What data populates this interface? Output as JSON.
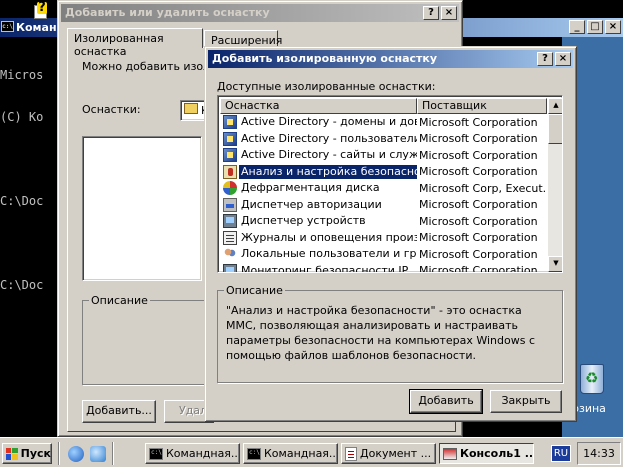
{
  "console": {
    "title": "Команд",
    "lines": [
      "Micros",
      "(C) Ко",
      "",
      "C:\\Doc",
      "",
      "C:\\Doc"
    ]
  },
  "back_dialog": {
    "title": "Добавить или удалить оснастку",
    "tabs": [
      "Изолированная оснастка",
      "Расширения"
    ],
    "intro_text": "Можно добавить изолир",
    "snapins_label": "Оснастки:",
    "combo_value": "К",
    "description_label": "Описание",
    "add_button": "Добавить...",
    "remove_button": "Удал"
  },
  "front_dialog": {
    "title": "Добавить изолированную оснастку",
    "available_label": "Доступные изолированные оснастки:",
    "columns": [
      "Оснастка",
      "Поставщик"
    ],
    "rows": [
      {
        "name": "Active Directory - домены и дове...",
        "vendor": "Microsoft Corporation",
        "icon": "ad"
      },
      {
        "name": "Active Directory - пользователи ...",
        "vendor": "Microsoft Corporation",
        "icon": "ad"
      },
      {
        "name": "Active Directory - сайты и службы",
        "vendor": "Microsoft Corporation",
        "icon": "ad"
      },
      {
        "name": "Анализ и настройка безопасности",
        "vendor": "Microsoft Corporation",
        "icon": "sec",
        "selected": true
      },
      {
        "name": "Дефрагментация диска",
        "vendor": "Microsoft Corp, Execut...",
        "icon": "defrag"
      },
      {
        "name": "Диспетчер авторизации",
        "vendor": "Microsoft Corporation",
        "icon": "auth"
      },
      {
        "name": "Диспетчер устройств",
        "vendor": "Microsoft Corporation",
        "icon": "dev"
      },
      {
        "name": "Журналы и оповещения произв...",
        "vendor": "Microsoft Corporation",
        "icon": "log"
      },
      {
        "name": "Локальные пользователи и груп...",
        "vendor": "Microsoft Corporation",
        "icon": "users"
      },
      {
        "name": "Мониторинг безопасности IP",
        "vendor": "Microsoft Corporation",
        "icon": "dev"
      }
    ],
    "description_label": "Описание",
    "description_text": "\"Анализ и настройка безопасности\" - это оснастка MMC, позволяющая анализировать и настраивать параметры безопасности на компьютерах Windows с помощью файлов шаблонов безопасности.",
    "add_button": "Добавить",
    "close_button": "Закрыть"
  },
  "desktop": {
    "recycle_label": "рзина"
  },
  "taskbar": {
    "start_label": "Пуск",
    "buttons": [
      {
        "label": "Командная...",
        "icon": "cmd"
      },
      {
        "label": "Командная...",
        "icon": "cmd"
      },
      {
        "label": "Документ ...",
        "icon": "doc"
      },
      {
        "label": "Консоль1 ...",
        "icon": "mmc",
        "active": true
      }
    ],
    "language": "RU",
    "clock": "14:33"
  }
}
